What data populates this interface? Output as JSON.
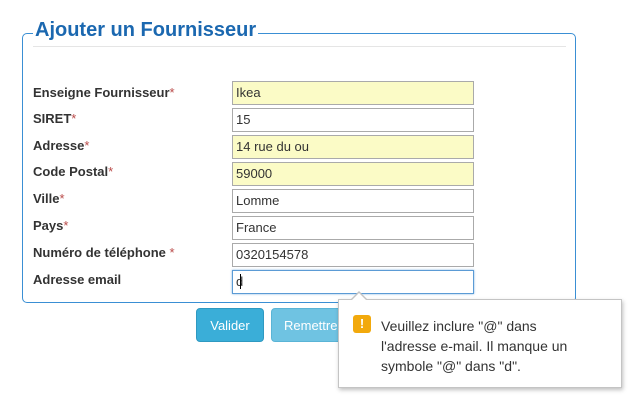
{
  "form": {
    "title": "Ajouter un Fournisseur",
    "required_marker": "*",
    "fields": [
      {
        "label": "Enseigne Fournisseur",
        "required": true,
        "value": "Ikea"
      },
      {
        "label": "SIRET",
        "required": true,
        "value": "15"
      },
      {
        "label": "Adresse",
        "required": true,
        "value": "14 rue du ou"
      },
      {
        "label": "Code Postal",
        "required": true,
        "value": "59000"
      },
      {
        "label": "Ville",
        "required": true,
        "value": "Lomme"
      },
      {
        "label": "Pays",
        "required": true,
        "value": "France"
      },
      {
        "label": "Numéro de téléphone ",
        "required": true,
        "value": "0320154578"
      },
      {
        "label": "Adresse email",
        "required": false,
        "value": "d"
      }
    ]
  },
  "buttons": {
    "submit_label": "Valider",
    "reset_label": "Remettre"
  },
  "validation_tooltip": {
    "icon": "warning-icon",
    "icon_glyph": "!",
    "line1": "Veuillez inclure \"@\" dans",
    "line2": "l'adresse e-mail. Il manque un",
    "line3": "symbole \"@\" dans \"d\"."
  },
  "colors": {
    "accent": "#1b68b0",
    "autofill": "#fbfbc6",
    "button": "#3aaed8",
    "warning": "#f2a90c"
  }
}
